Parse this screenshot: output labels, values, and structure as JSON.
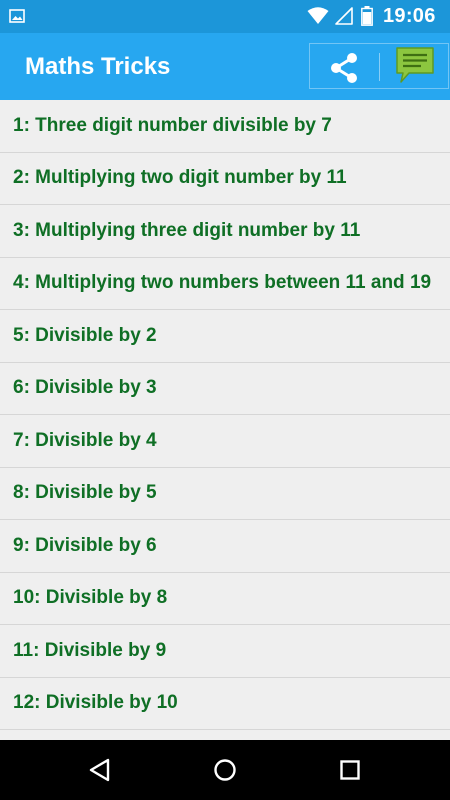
{
  "status_bar": {
    "time": "19:06",
    "icons": [
      "gallery-icon",
      "wifi-icon",
      "signal-icon",
      "battery-icon"
    ],
    "color": "#1c96d9"
  },
  "app_bar": {
    "title": "Maths Tricks",
    "color": "#27a7f0",
    "actions": [
      "share-icon",
      "message-icon"
    ]
  },
  "list": {
    "text_color": "#0f6f25",
    "items": [
      {
        "label": "1: Three digit number divisible by 7"
      },
      {
        "label": "2: Multiplying two digit number by 11"
      },
      {
        "label": "3: Multiplying three digit number by 11"
      },
      {
        "label": "4: Multiplying two numbers between 11 and 19"
      },
      {
        "label": "5: Divisible by 2"
      },
      {
        "label": "6: Divisible by 3"
      },
      {
        "label": "7: Divisible by 4"
      },
      {
        "label": "8: Divisible by 5"
      },
      {
        "label": "9: Divisible by 6"
      },
      {
        "label": "10: Divisible by 8"
      },
      {
        "label": "11: Divisible by 9"
      },
      {
        "label": "12: Divisible by 10"
      }
    ]
  },
  "nav_bar": {
    "buttons": [
      "back-icon",
      "home-icon",
      "recents-icon"
    ]
  }
}
